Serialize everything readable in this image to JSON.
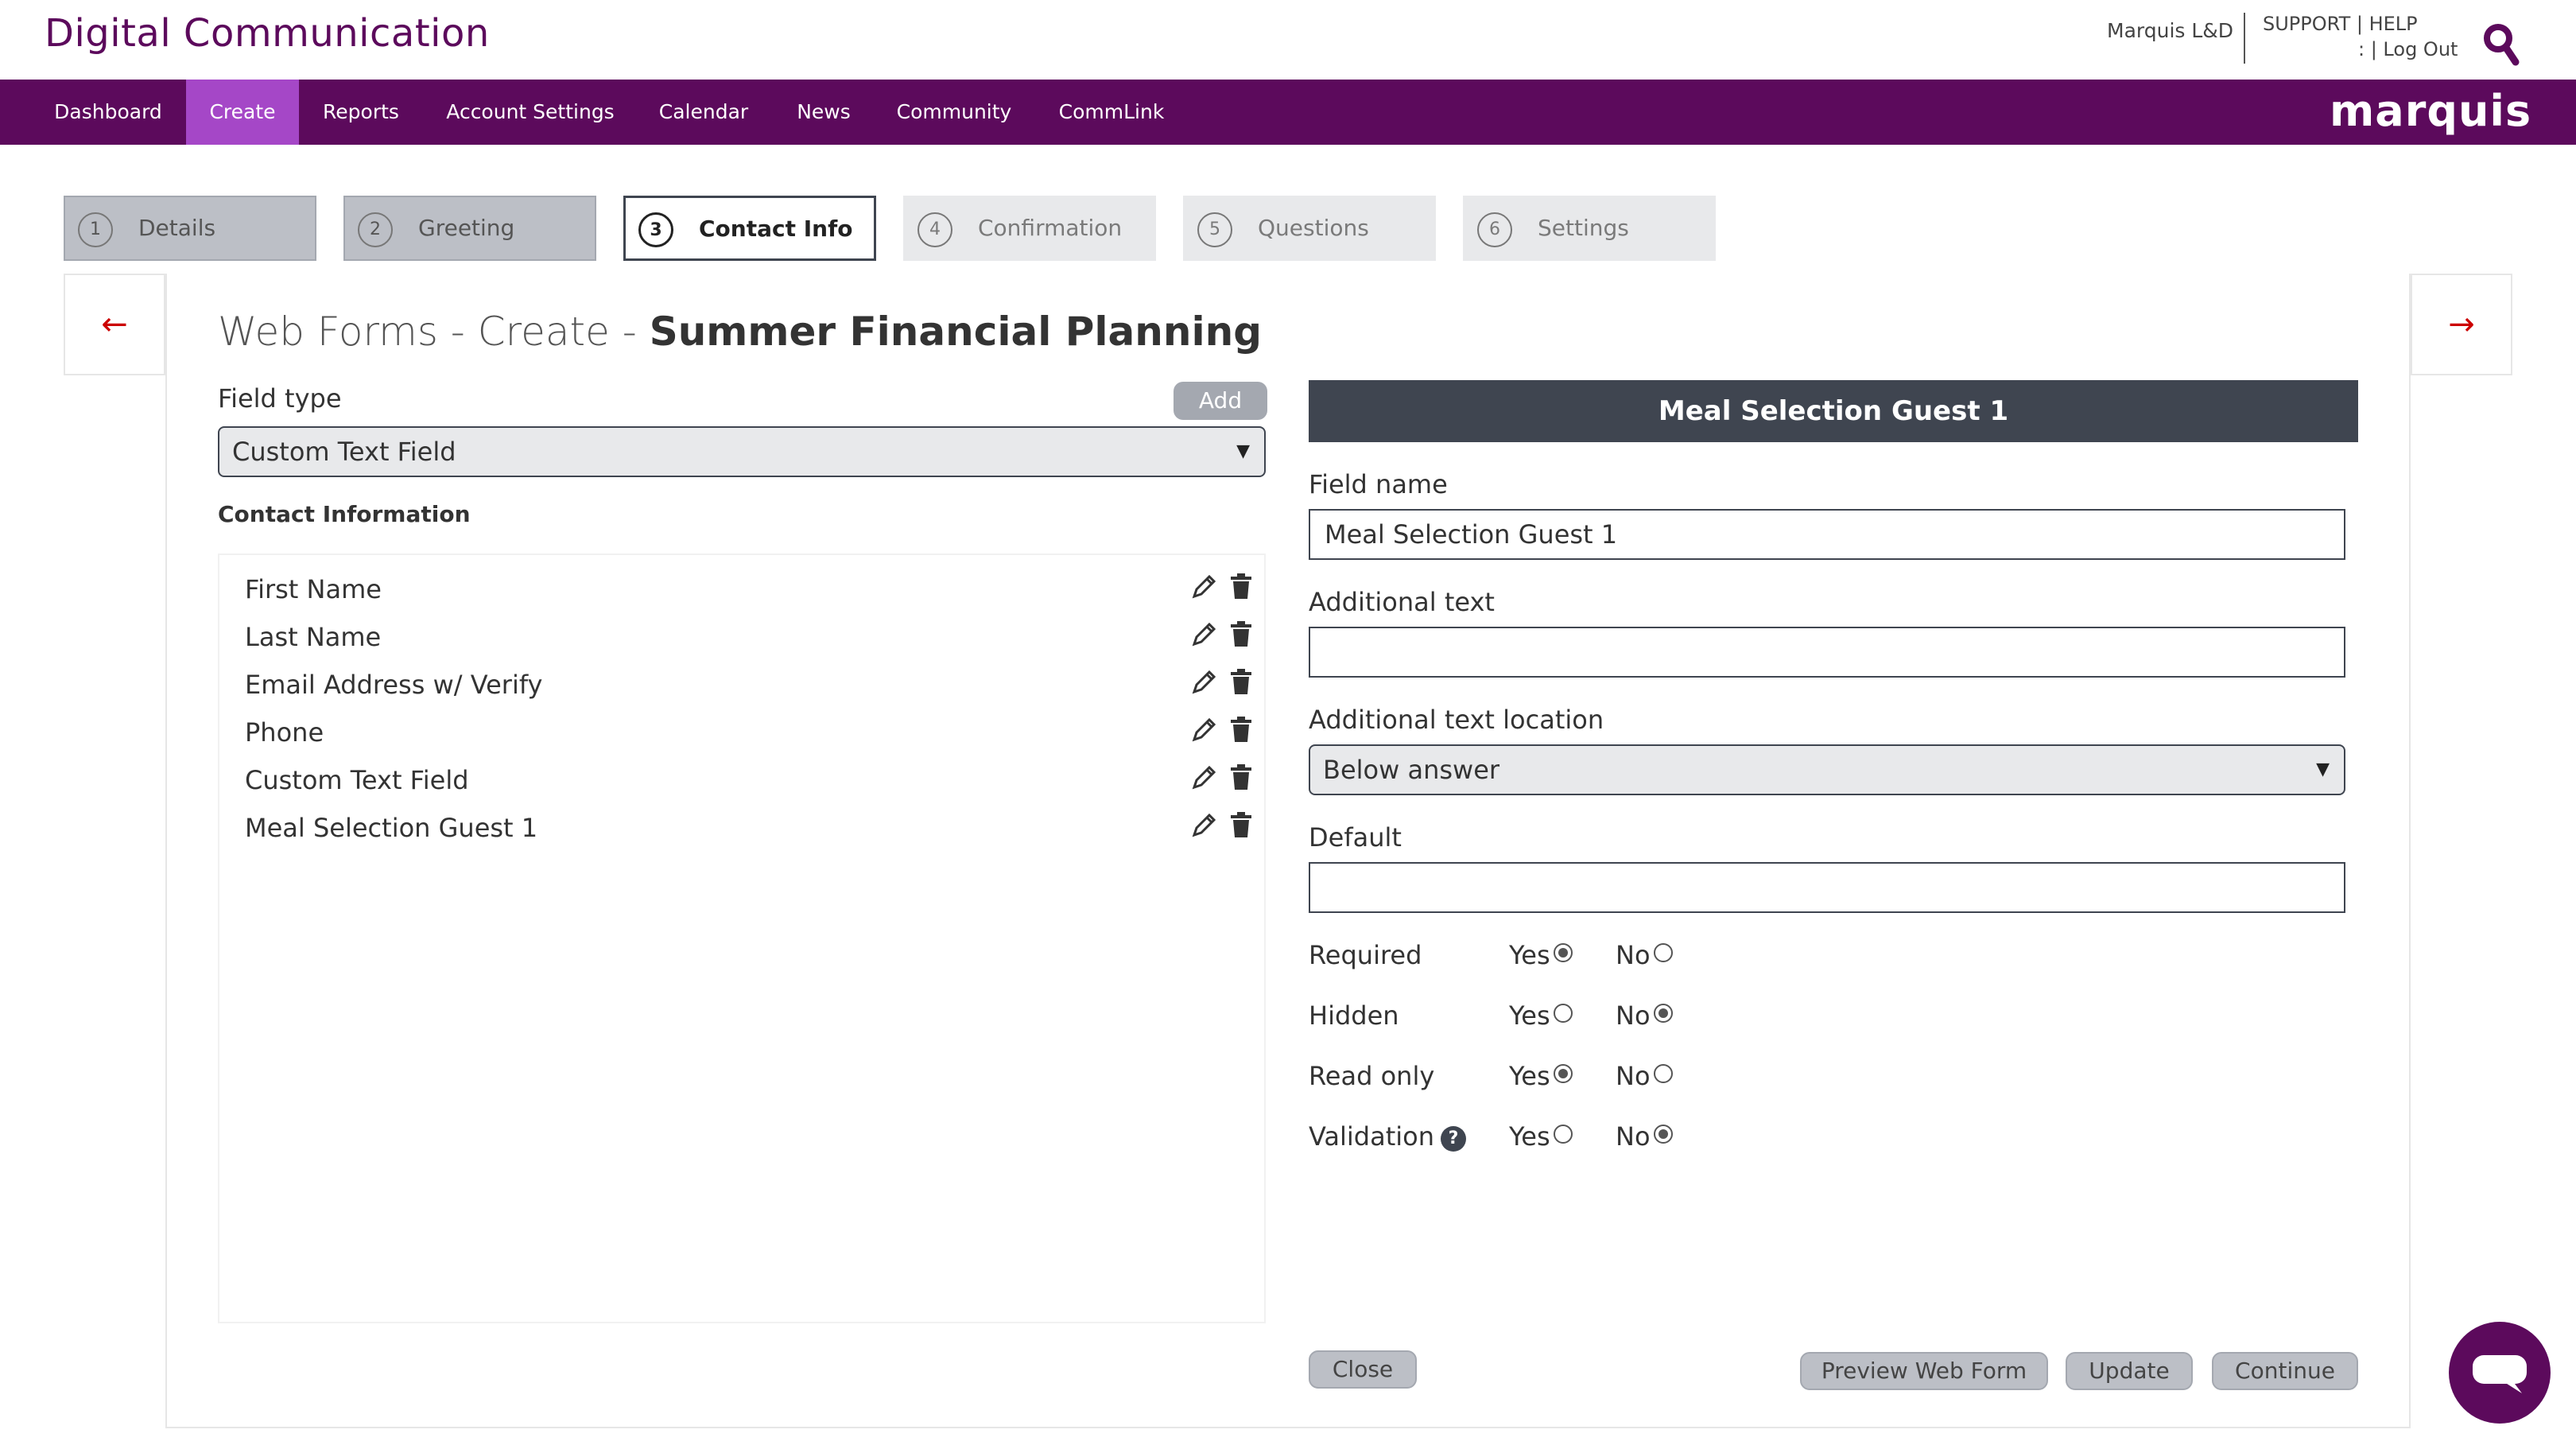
{
  "header": {
    "brand": "Digital Communication",
    "account": "Marquis L&D",
    "support": "SUPPORT | HELP",
    "logout": ": | Log Out"
  },
  "nav": {
    "items": [
      "Dashboard",
      "Create",
      "Reports",
      "Account Settings",
      "Calendar",
      "News",
      "Community",
      "CommLink"
    ],
    "active": "Create",
    "logo": "marquis",
    "colors": {
      "nav_bg": "#5c0a5c",
      "active_bg": "#a547c7"
    }
  },
  "steps": [
    {
      "num": "1",
      "label": "Details",
      "state": "done"
    },
    {
      "num": "2",
      "label": "Greeting",
      "state": "done"
    },
    {
      "num": "3",
      "label": "Contact Info",
      "state": "current"
    },
    {
      "num": "4",
      "label": "Confirmation",
      "state": "upcoming"
    },
    {
      "num": "5",
      "label": "Questions",
      "state": "upcoming"
    },
    {
      "num": "6",
      "label": "Settings",
      "state": "upcoming"
    }
  ],
  "page": {
    "title_prefix": "Web Forms - Create - ",
    "title_name": "Summer Financial Planning",
    "prev_arrow": "←",
    "next_arrow": "→"
  },
  "left": {
    "field_type_label": "Field type",
    "add_label": "Add",
    "field_type_value": "Custom Text Field",
    "section_title": "Contact Information",
    "fields": [
      "First Name",
      "Last Name",
      "Email Address w/ Verify",
      "Phone",
      "Custom Text Field",
      "Meal Selection Guest 1"
    ]
  },
  "right": {
    "header": "Meal Selection Guest 1",
    "field_name_label": "Field name",
    "field_name_value": "Meal Selection Guest 1",
    "additional_text_label": "Additional text",
    "additional_text_value": "",
    "additional_text_location_label": "Additional text location",
    "additional_text_location_value": "Below answer",
    "default_label": "Default",
    "default_value": "",
    "yes_label": "Yes",
    "no_label": "No",
    "options": [
      {
        "label": "Required",
        "selected": "Yes"
      },
      {
        "label": "Hidden",
        "selected": "No"
      },
      {
        "label": "Read only",
        "selected": "Yes"
      },
      {
        "label": "Validation",
        "selected": "No",
        "help": "?"
      }
    ],
    "buttons": {
      "close": "Close",
      "preview": "Preview Web Form",
      "update": "Update",
      "continue": "Continue"
    }
  }
}
